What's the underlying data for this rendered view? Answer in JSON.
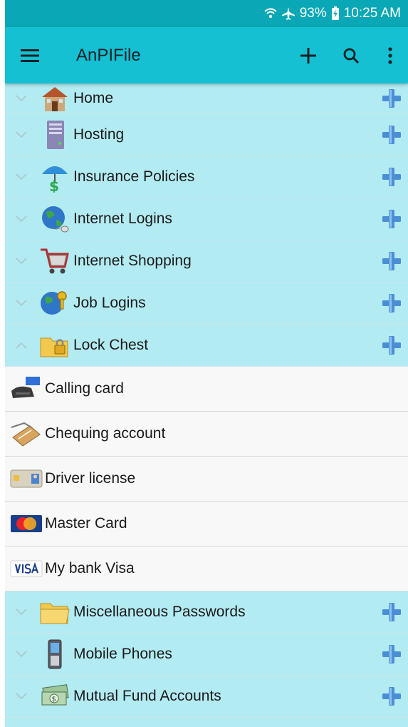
{
  "status": {
    "battery": "93%",
    "time": "10:25 AM"
  },
  "appbar": {
    "title": "AnPIFile",
    "menu_icon": "hamburger-icon",
    "add_icon": "plus-icon",
    "search_icon": "search-icon",
    "overflow_icon": "more-vert-icon"
  },
  "groups_top": [
    {
      "label": "Home",
      "icon": "house-icon"
    },
    {
      "label": "Hosting",
      "icon": "server-icon"
    },
    {
      "label": "Insurance Policies",
      "icon": "umbrella-money-icon"
    },
    {
      "label": "Internet Logins",
      "icon": "globe-mouse-icon"
    },
    {
      "label": "Internet Shopping",
      "icon": "shopping-cart-icon"
    },
    {
      "label": "Job Logins",
      "icon": "globe-key-icon"
    },
    {
      "label": "Lock Chest",
      "icon": "lock-folder-icon",
      "expanded": true
    }
  ],
  "children": [
    {
      "label": "Calling card",
      "icon": "telephone-card-icon"
    },
    {
      "label": "Chequing account",
      "icon": "cheque-icon"
    },
    {
      "label": "Driver license",
      "icon": "id-card-icon"
    },
    {
      "label": "Master Card",
      "icon": "mastercard-icon"
    },
    {
      "label": "My bank Visa",
      "icon": "visa-icon"
    }
  ],
  "groups_bottom": [
    {
      "label": "Miscellaneous Passwords",
      "icon": "folder-icon"
    },
    {
      "label": "Mobile Phones",
      "icon": "mobile-phone-icon"
    },
    {
      "label": "Mutual Fund Accounts",
      "icon": "money-icon"
    }
  ],
  "colors": {
    "status_bar": "#0aa7b6",
    "app_bar": "#14c0d2",
    "group_row": "#b3ebf2",
    "child_row": "#f8f8f8",
    "plus_blue": "#4a8fd6"
  }
}
